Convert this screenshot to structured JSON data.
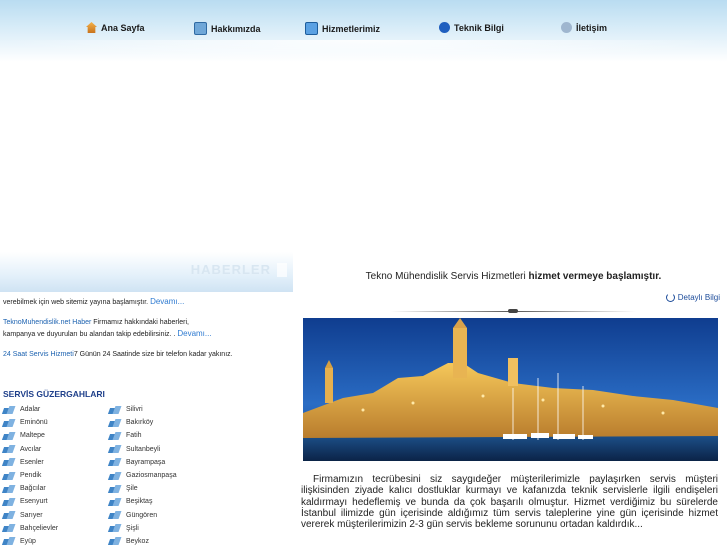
{
  "nav": {
    "items": [
      {
        "label": "Ana Sayfa",
        "icon": "home-icon"
      },
      {
        "label": "Hakkımızda",
        "icon": "document-icon"
      },
      {
        "label": "Hizmetlerimiz",
        "icon": "list-icon"
      },
      {
        "label": "Teknik Bilgi",
        "icon": "info-icon"
      },
      {
        "label": "İletişim",
        "icon": "search-icon"
      }
    ]
  },
  "news": {
    "header": "HABERLER",
    "item1_text": "verebilmek için web sitemiz yayına başlamıştır.",
    "item1_more": "Devamı...",
    "item2_title": "TeknoMuhendislik.net Haber",
    "item2_text_a": "Firmamız hakkındaki haberleri,",
    "item2_text_b": "kampanya ve duyuruları bu alandan takip edebilirsiniz. .",
    "item2_more": "Devamı...",
    "item3_title": "24 Saat Servis Hizmeti",
    "item3_text": "7 Günün 24 Saatinde size bir telefon kadar yakınız."
  },
  "routes": {
    "title": "SERVİS GÜZERGAHLARI",
    "col1": [
      "Adalar",
      "Eminönü",
      "Maltepe",
      "Avcılar",
      "Esenler",
      "Pendik",
      "Bağcılar",
      "Esenyurt",
      "Sarıyer",
      "Bahçelievler",
      "Eyüp"
    ],
    "col2": [
      "Silivri",
      "Bakırköy",
      "Fatih",
      "Sultanbeyli",
      "Bayrampaşa",
      "Gaziosmanpaşa",
      "Şile",
      "Beşiktaş",
      "Güngören",
      "Şişli",
      "Beykoz"
    ]
  },
  "main": {
    "headline_normal": "Tekno Mühendislik Servis Hizmetleri",
    "headline_bold": "hizmet vermeye başlamıştır.",
    "detail_link": "Detaylı Bilgi",
    "about_text": "Firmamızın tecrübesini siz saygıdeğer müşterilerimizle paylaşırken servis müşteri ilişkisinden ziyade kalıcı dostluklar kurmayı ve kafanızda teknik servislerle ilgili endişeleri kaldırmayı hedeflemiş ve bunda da çok başarılı olmuştur. Hizmet verdiğimiz bu sürelerde İstanbul ilimizde gün içerisinde aldığımız tüm servis taleplerine yine gün içerisinde hizmet vererek müşterilerimizin 2-3 gün servis bekleme sorununu ortadan kaldırdık..."
  },
  "colors": {
    "nav_gradient_top": "#b9dcf1",
    "link": "#1c62b0",
    "route_title": "#1e3f8a"
  }
}
